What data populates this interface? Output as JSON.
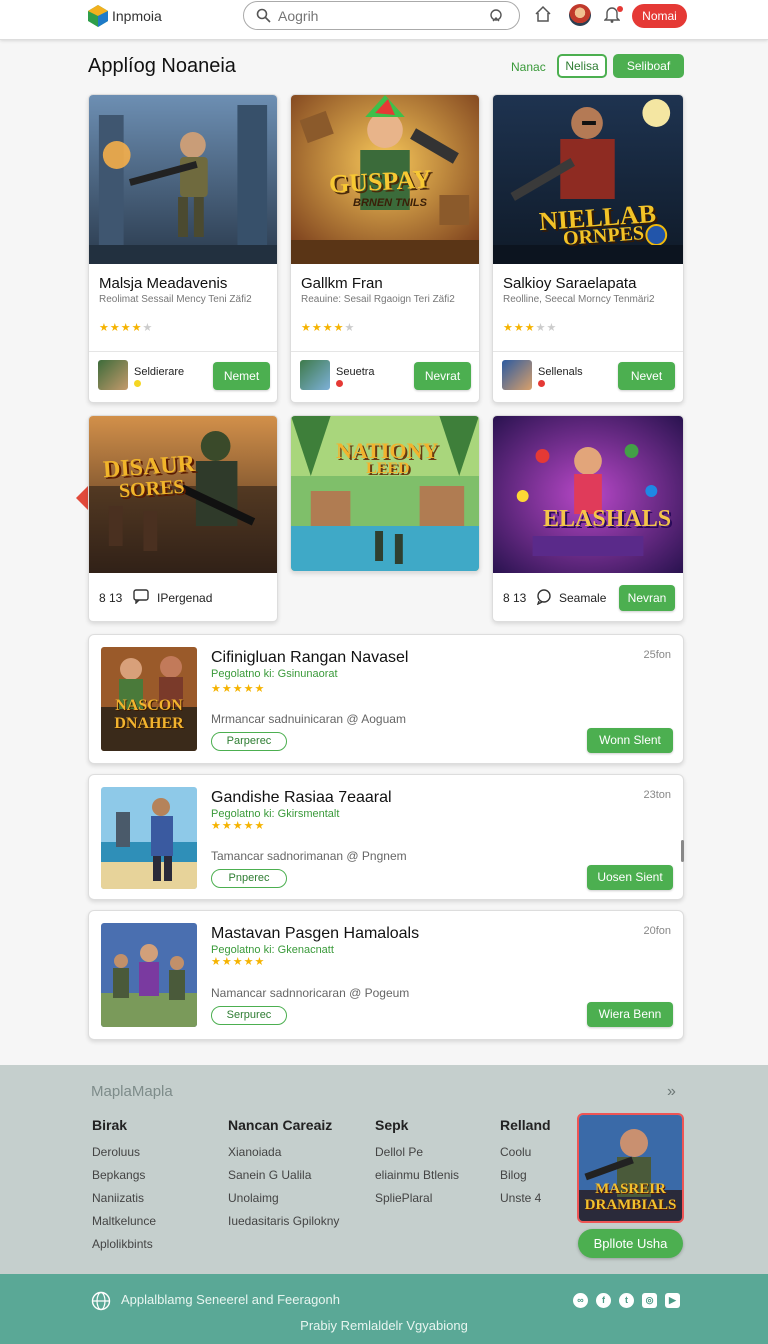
{
  "header": {
    "brand": "Inpmoia",
    "search_placeholder": "Aogrih",
    "action_label": "Nomai"
  },
  "page": {
    "title": "Applíog Noaneia",
    "link": "Nanac",
    "btn_outline": "Nelisa",
    "btn_fill": "Seliboaf"
  },
  "games": [
    {
      "title": "Malsja Meadavenis",
      "sub": "Reolimat Sessail Mency Teni Zäfi2",
      "rating": 3.5,
      "dev": "Seldierare",
      "button": "Nemet"
    },
    {
      "title": "Gallkm Fran",
      "sub": "Reauine: Sesail Rgaoign Teri Zäfi2",
      "rating": 3.5,
      "dev": "Seuetra",
      "button": "Nevrat"
    },
    {
      "title": "Salkioy Saraelapata",
      "sub": "Reolline, Seecal Morncy Tenmäri2",
      "rating": 3,
      "dev": "Sellenals",
      "button": "Nevet"
    }
  ],
  "art_text": [
    "GUSPAY",
    "BRNEN TNILS",
    "NIELLAB",
    "ORNPES",
    "DISAUR",
    "SORES",
    "NATIONY",
    "LEED",
    "ELASHALS"
  ],
  "row2": [
    {
      "count": "8 13",
      "label": "IPergenad"
    },
    {
      "count": "8 13",
      "label": "Seamale",
      "button": "Nevran"
    }
  ],
  "list": [
    {
      "title": "Cifinigluan Rangan Navasel",
      "sub": "Pegolatno ki: Gsinunaorat",
      "rating": 5,
      "meta": "Mrmancar sadnuinicaran  @  Aoguam",
      "tag": "Parperec",
      "time": "25fon",
      "button": "Wonn Slent",
      "art": "NASCON DNAHER"
    },
    {
      "title": "Gandishe Rasiaa 7eaaral",
      "sub": "Pegolatno ki: Gkirsmentalt",
      "rating": 5,
      "meta": "Tamancar sadnorimanan  @  Pngnem",
      "tag": "Pnperec",
      "time": "23ton",
      "button": "Uosen Sient"
    },
    {
      "title": "Mastavan Pasgen Hamaloals",
      "sub": "Pegolatno ki: Gkenacnatt",
      "rating": 5,
      "meta": "Namancar sadnnoricaran  @  Pogeum",
      "tag": "Serpurec",
      "time": "20fon",
      "button": "Wiera Benn"
    }
  ],
  "footer": {
    "heading": "MaplaMapla",
    "columns": [
      {
        "title": "Birak",
        "links": [
          "Deroluus",
          "Bepkangs",
          "Naniizatis",
          "Maltkelunce",
          "Aplolikbints"
        ]
      },
      {
        "title": "Nancan Careaiz",
        "links": [
          "Xianoiada",
          "Sanein G Ualila",
          "Unolaimg",
          "Iuedasitaris Gpilokny"
        ]
      },
      {
        "title": "Sepk",
        "links": [
          "Dellol Pe",
          "eliainmu Btlenis",
          "SpliePlaral"
        ]
      },
      {
        "title": "Relland",
        "links": [
          "Coolu",
          "Bilog",
          "Unste  4"
        ]
      }
    ],
    "promo_art": "MASREIR DRAMBIALS",
    "promo_button": "Bpllote Usha"
  },
  "bottom": {
    "text": "Applalblamg Seneerel and Feeragonh",
    "copyright": "Prabiy Remlaldelr Vgyabiong"
  }
}
